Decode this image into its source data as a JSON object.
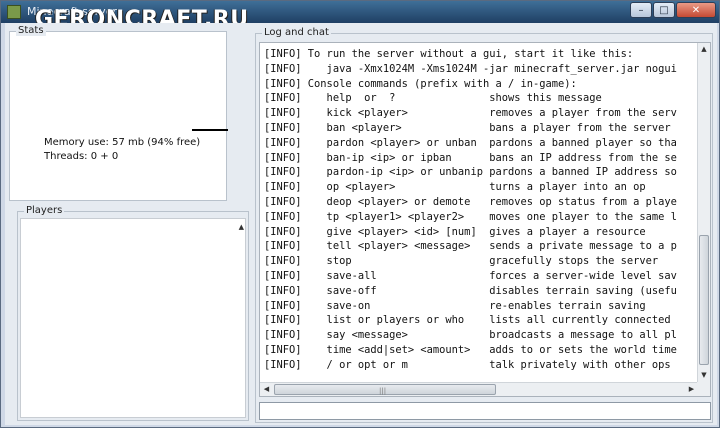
{
  "window": {
    "title": "Minecraft server",
    "watermark": "GERONCRAFT.RU",
    "controls": {
      "minimize": "–",
      "maximize": "□",
      "close": "✕"
    }
  },
  "stats": {
    "label": "Stats",
    "memory": "Memory use: 57 mb (94% free)",
    "threads": "Threads: 0 + 0"
  },
  "players": {
    "label": "Players",
    "items": []
  },
  "log": {
    "label": "Log and chat",
    "lines": [
      "[INFO] To run the server without a gui, start it like this:",
      "[INFO]    java -Xmx1024M -Xms1024M -jar minecraft_server.jar nogui",
      "[INFO] Console commands (prefix with a / in-game):",
      "[INFO]    help  or  ?               shows this message",
      "[INFO]    kick <player>             removes a player from the serv",
      "[INFO]    ban <player>              bans a player from the server",
      "[INFO]    pardon <player> or unban  pardons a banned player so tha",
      "[INFO]    ban-ip <ip> or ipban      bans an IP address from the se",
      "[INFO]    pardon-ip <ip> or unbanip pardons a banned IP address so",
      "[INFO]    op <player>               turns a player into an op",
      "[INFO]    deop <player> or demote   removes op status from a playe",
      "[INFO]    tp <player1> <player2>    moves one player to the same l",
      "[INFO]    give <player> <id> [num]  gives a player a resource",
      "[INFO]    tell <player> <message>   sends a private message to a p",
      "[INFO]    stop                      gracefully stops the server",
      "[INFO]    save-all                  forces a server-wide level sav",
      "[INFO]    save-off                  disables terrain saving (usefu",
      "[INFO]    save-on                   re-enables terrain saving",
      "[INFO]    list or players or who    lists all currently connected",
      "[INFO]    say <message>             broadcasts a message to all pl",
      "[INFO]    time <add|set> <amount>   adds to or sets the world time",
      "[INFO]    / or opt or m             talk privately with other ops"
    ],
    "input_value": ""
  }
}
